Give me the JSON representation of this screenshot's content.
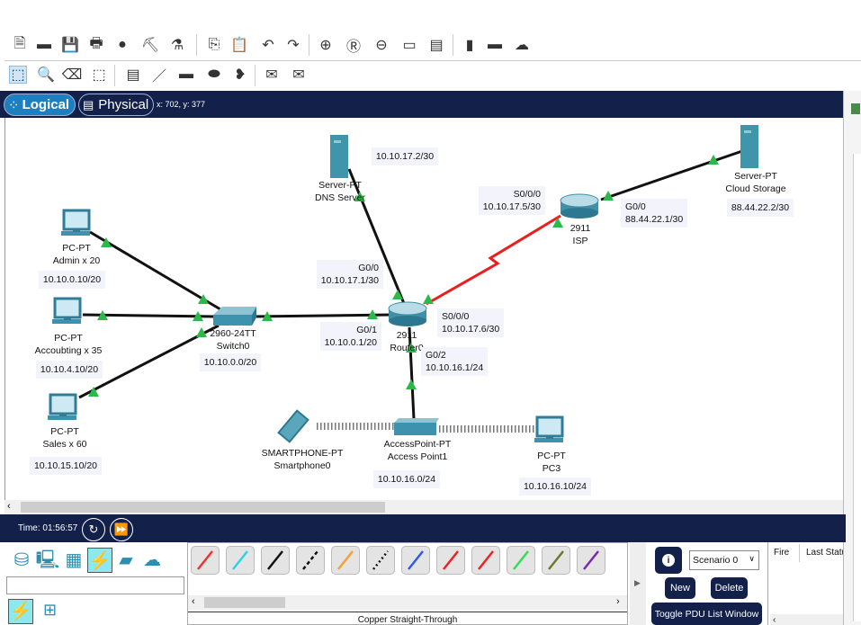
{
  "toolbar": {
    "row1_icons": [
      "new-file-icon",
      "open-folder-icon",
      "save-icon",
      "print-icon",
      "info-icon",
      "activity-wizard-icon",
      "custom-device-icon",
      "copy-icon",
      "paste-icon",
      "undo-icon",
      "redo-icon",
      "zoom-in-icon",
      "zoom-reset-icon",
      "zoom-out-icon",
      "drawing-palette-icon",
      "custom-devices-dialog-icon",
      "pdu-list-icon",
      "cluster-icon",
      "cloud-icon"
    ],
    "row2_icons": [
      "select-icon",
      "inspect-icon",
      "delete-icon",
      "resize-icon",
      "note-icon",
      "line-icon",
      "rectangle-icon",
      "ellipse-icon",
      "freeform-icon",
      "add-simple-pdu-icon",
      "add-complex-pdu-icon"
    ]
  },
  "tabs": {
    "logical": "Logical",
    "physical": "Physical",
    "coords": "x: 702, y: 377"
  },
  "devices": {
    "pc_admin": {
      "model": "PC-PT",
      "name": "Admin x 20",
      "ip": "10.10.0.10/20"
    },
    "pc_accounting": {
      "model": "PC-PT",
      "name": "Accoubting x 35",
      "ip": "10.10.4.10/20"
    },
    "pc_sales": {
      "model": "PC-PT",
      "name": "Sales x 60",
      "ip": "10.10.15.10/20"
    },
    "switch0": {
      "model": "2960-24TT",
      "name": "Switch0",
      "ip": "10.10.0.0/20"
    },
    "router0": {
      "model": "2911",
      "name": "Router0"
    },
    "dns_server": {
      "model": "Server-PT",
      "name": "DNS Server",
      "ip": "10.10.17.2/30"
    },
    "isp": {
      "model": "2911",
      "name": "ISP"
    },
    "cloud_storage": {
      "model": "Server-PT",
      "name": "Cloud Storage",
      "ip": "88.44.22.2/30"
    },
    "access_point": {
      "model": "AccessPoint-PT",
      "name": "Access Point1",
      "ip": "10.10.16.0/24"
    },
    "smartphone": {
      "model": "SMARTPHONE-PT",
      "name": "Smartphone0"
    },
    "pc3": {
      "model": "PC-PT",
      "name": "PC3",
      "ip": "10.10.16.10/24"
    }
  },
  "interfaces": {
    "isp_s000": {
      "port": "S0/0/0",
      "ip": "10.10.17.5/30"
    },
    "isp_g00": {
      "port": "G0/0",
      "ip": "88.44.22.1/30"
    },
    "r0_g00": {
      "port": "G0/0",
      "ip": "10.10.17.1/30"
    },
    "r0_g01": {
      "port": "G0/1",
      "ip": "10.10.0.1/20"
    },
    "r0_s000": {
      "port": "S0/0/0",
      "ip": "10.10.17.6/30"
    },
    "r0_g02": {
      "port": "G0/2",
      "ip": "10.10.16.1/24"
    }
  },
  "colors": {
    "link_up": "#2db84a",
    "serial": "#ee1c1c",
    "copper": "#111111",
    "navy": "#13204a"
  },
  "timebar": {
    "time": "Time: 01:56:57"
  },
  "bottom": {
    "categories": [
      "network-devices-icon",
      "end-devices-icon",
      "components-icon",
      "connections-icon",
      "miscellaneous-icon",
      "multiuser-icon"
    ],
    "cables": [
      "automatic-cable",
      "console",
      "copper-straight-through",
      "copper-cross-over",
      "fiber",
      "phone",
      "coaxial",
      "serial-dce",
      "serial-dte",
      "octal",
      "iot-custom",
      "usb"
    ],
    "selected_cable": "Copper Straight-Through",
    "scenario": "Scenario 0",
    "new": "New",
    "delete": "Delete",
    "toggle_pdu": "Toggle PDU List Window",
    "table_headers": [
      "Fire",
      "Last Status"
    ]
  }
}
